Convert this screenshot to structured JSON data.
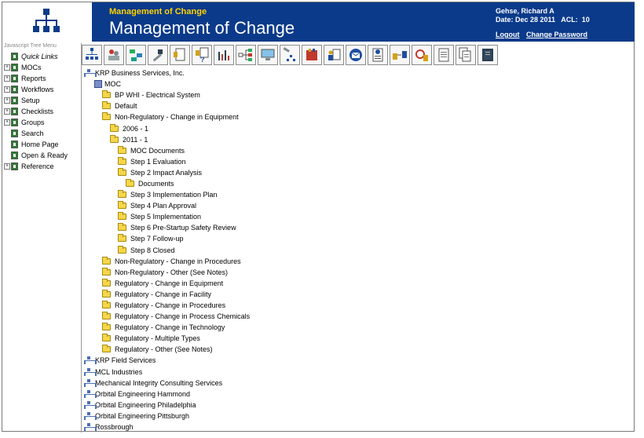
{
  "header": {
    "small_title": "Management of Change",
    "big_title": "Management of Change",
    "user_name": "Gehse, Richard A",
    "date_acl": "Date: Dec 28 2011   ACL:  10",
    "logout": "Logout",
    "change_password": "Change Password",
    "accent": "#0b3a8a",
    "highlight": "#ffd200"
  },
  "menu_title": "Javascript Tree Menu",
  "nav": [
    {
      "label": "Quick Links",
      "expand": false
    },
    {
      "label": "MOCs",
      "expand": true
    },
    {
      "label": "Reports",
      "expand": true
    },
    {
      "label": "Workflows",
      "expand": true
    },
    {
      "label": "Setup",
      "expand": true
    },
    {
      "label": "Checklists",
      "expand": true
    },
    {
      "label": "Groups",
      "expand": true
    },
    {
      "label": "Search",
      "expand": false
    },
    {
      "label": "Home Page",
      "expand": false
    },
    {
      "label": "Open & Ready",
      "expand": false
    },
    {
      "label": "Reference",
      "expand": true
    }
  ],
  "toolbar": [
    "org-chart-icon",
    "people-icon",
    "workflow-icon",
    "tools-icon",
    "document-icon",
    "question-document-icon",
    "bar-chart-icon",
    "flow-diagram-icon",
    "monitor-icon",
    "hierarchy-tools-icon",
    "binder-icon",
    "document-person-icon",
    "email-icon",
    "notes-icon",
    "transfer-icon",
    "alarm-clock-icon",
    "page-icon",
    "pages-icon",
    "notebook-icon"
  ],
  "tree": [
    {
      "label": "KRP Business Services, Inc.",
      "type": "org",
      "indent": 0
    },
    {
      "label": "MOC",
      "type": "cube",
      "indent": 1
    },
    {
      "label": "BP WHI - Electrical System",
      "type": "folder",
      "indent": 2
    },
    {
      "label": "Default",
      "type": "folder",
      "indent": 2
    },
    {
      "label": "Non-Regulatory - Change in Equipment",
      "type": "folder",
      "indent": 2
    },
    {
      "label": "2006 - 1",
      "type": "folder",
      "indent": 3
    },
    {
      "label": "2011 - 1",
      "type": "folder",
      "indent": 3
    },
    {
      "label": "MOC Documents",
      "type": "folder",
      "indent": 4
    },
    {
      "label": "Step 1 Evaluation",
      "type": "folder",
      "indent": 4
    },
    {
      "label": "Step 2 Impact Analysis",
      "type": "folder",
      "indent": 4
    },
    {
      "label": "Documents",
      "type": "folder",
      "indent": 5
    },
    {
      "label": "Step 3 Implementation Plan",
      "type": "folder",
      "indent": 4
    },
    {
      "label": "Step 4 Plan Approval",
      "type": "folder",
      "indent": 4
    },
    {
      "label": "Step 5 Implementation",
      "type": "folder",
      "indent": 4
    },
    {
      "label": "Step 6 Pre-Startup Safety Review",
      "type": "folder",
      "indent": 4
    },
    {
      "label": "Step 7 Follow-up",
      "type": "folder",
      "indent": 4
    },
    {
      "label": "Step 8 Closed",
      "type": "folder",
      "indent": 4
    },
    {
      "label": "Non-Regulatory - Change in Procedures",
      "type": "folder",
      "indent": 2
    },
    {
      "label": "Non-Regulatory - Other (See Notes)",
      "type": "folder",
      "indent": 2
    },
    {
      "label": "Regulatory - Change in Equipment",
      "type": "folder",
      "indent": 2
    },
    {
      "label": "Regulatory - Change in Facility",
      "type": "folder",
      "indent": 2
    },
    {
      "label": "Regulatory - Change in Procedures",
      "type": "folder",
      "indent": 2
    },
    {
      "label": "Regulatory - Change in Process Chemicals",
      "type": "folder",
      "indent": 2
    },
    {
      "label": "Regulatory - Change in Technology",
      "type": "folder",
      "indent": 2
    },
    {
      "label": "Regulatory - Multiple Types",
      "type": "folder",
      "indent": 2
    },
    {
      "label": "Regulatory - Other (See Notes)",
      "type": "folder",
      "indent": 2
    },
    {
      "label": "KRP Field Services",
      "type": "org",
      "indent": 0
    },
    {
      "label": "MCL Industries",
      "type": "org",
      "indent": 0
    },
    {
      "label": "Mechanical Integrity Consulting Services",
      "type": "org",
      "indent": 0
    },
    {
      "label": "Orbital Engineering Hammond",
      "type": "org",
      "indent": 0
    },
    {
      "label": "Orbital Engineering Philadelphia",
      "type": "org",
      "indent": 0
    },
    {
      "label": "Orbital Engineering Pittsburgh",
      "type": "org",
      "indent": 0
    },
    {
      "label": "Rossbrough",
      "type": "org",
      "indent": 0
    }
  ]
}
